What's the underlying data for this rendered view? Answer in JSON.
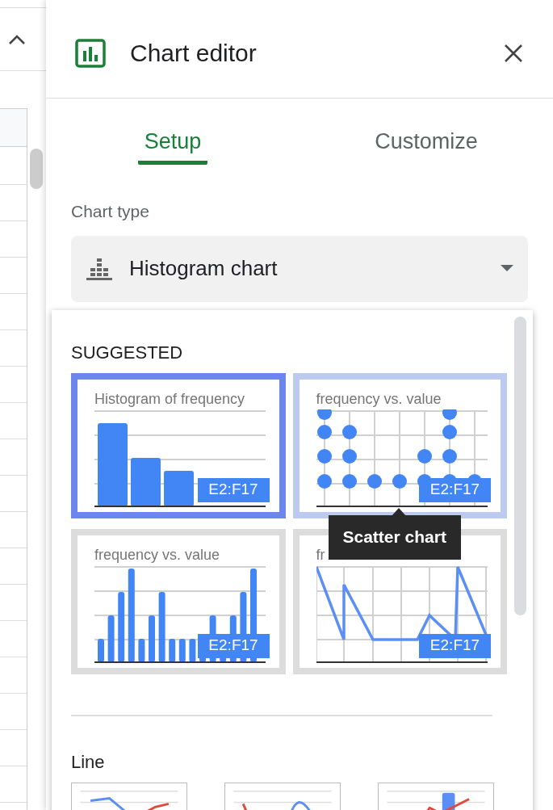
{
  "window": {
    "title": "Chart editor"
  },
  "tabs": [
    {
      "label": "Setup",
      "selected": true
    },
    {
      "label": "Customize",
      "selected": false
    }
  ],
  "chart_type": {
    "label": "Chart type",
    "value": "Histogram chart"
  },
  "chart_menu": {
    "section": "SUGGESTED",
    "suggestions": [
      {
        "kind": "histogram",
        "title": "Histogram of frequency",
        "range": "E2:F17",
        "selected": true,
        "hovered": false
      },
      {
        "kind": "scatter",
        "title": "frequency vs. value",
        "range": "E2:F17",
        "selected": false,
        "hovered": true
      },
      {
        "kind": "column",
        "title": "frequency vs. value",
        "range": "E2:F17",
        "selected": false,
        "hovered": false
      },
      {
        "kind": "line",
        "title": "fr",
        "range": "E2:F17",
        "selected": false,
        "hovered": false
      }
    ],
    "tooltip": "Scatter chart",
    "groups": [
      {
        "title": "Line",
        "items": [
          {
            "kind": "line"
          },
          {
            "kind": "smooth"
          },
          {
            "kind": "combo"
          }
        ]
      }
    ]
  }
}
